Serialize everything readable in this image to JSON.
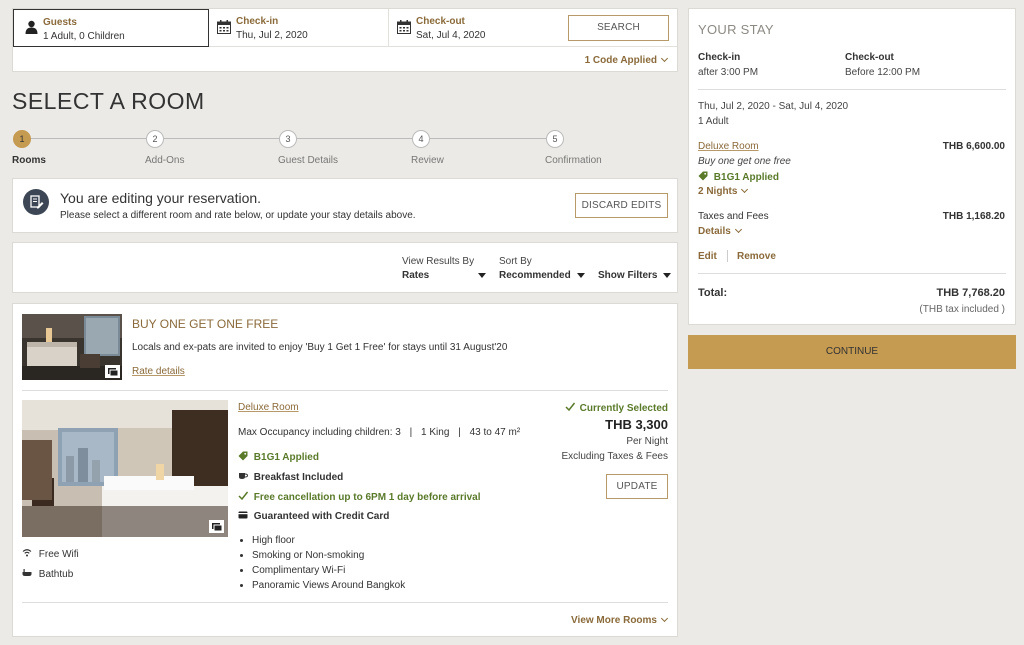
{
  "search_bar": {
    "guests_label": "Guests",
    "guests_value": "1 Adult, 0 Children",
    "checkin_label": "Check-in",
    "checkin_value": "Thu, Jul 2, 2020",
    "checkout_label": "Check-out",
    "checkout_value": "Sat, Jul 4, 2020",
    "search_button": "SEARCH",
    "codes_link": "1 Code Applied"
  },
  "page_title": "SELECT A ROOM",
  "steps": [
    {
      "num": "1",
      "label": "Rooms",
      "active": true
    },
    {
      "num": "2",
      "label": "Add-Ons"
    },
    {
      "num": "3",
      "label": "Guest Details"
    },
    {
      "num": "4",
      "label": "Review"
    },
    {
      "num": "5",
      "label": "Confirmation"
    }
  ],
  "edit_notice": {
    "title": "You are editing your reservation.",
    "subtitle": "Please select a different room and rate below, or update your stay details above.",
    "discard_button": "DISCARD EDITS"
  },
  "filters": {
    "view_by_label": "View Results By",
    "view_by_value": "Rates",
    "sort_label": "Sort By",
    "sort_value": "Recommended",
    "show_filters": "Show Filters"
  },
  "offer": {
    "title": "BUY ONE GET ONE FREE",
    "description": "Locals and ex-pats are invited to enjoy 'Buy 1 Get 1 Free' for stays until 31 August'20",
    "rate_details_link": "Rate details"
  },
  "room": {
    "name": "Deluxe Room",
    "occupancy": "Max Occupancy including children: 3",
    "bed": "1 King",
    "size": "43 to 47 m²",
    "promo_applied": "B1G1 Applied",
    "breakfast": "Breakfast Included",
    "cancellation": "Free cancellation up to 6PM 1 day before arrival",
    "guarantee": "Guaranteed with Credit Card",
    "features": [
      "High floor",
      "Smoking or Non-smoking",
      "Complimentary Wi-Fi",
      "Panoramic Views Around Bangkok"
    ],
    "amenities": [
      "Free Wifi",
      "Bathtub"
    ],
    "selected_label": "Currently Selected",
    "price": "THB 3,300",
    "per_night": "Per Night",
    "excl_taxes": "Excluding Taxes & Fees",
    "update_button": "UPDATE",
    "more_rooms_link": "View More Rooms"
  },
  "your_stay": {
    "title": "YOUR STAY",
    "checkin_label": "Check-in",
    "checkin_time": "after 3:00 PM",
    "checkout_label": "Check-out",
    "checkout_time": "Before 12:00 PM",
    "dates": "Thu, Jul 2, 2020 - Sat, Jul 4, 2020",
    "guests": "1 Adult",
    "room_name": "Deluxe Room",
    "room_price": "THB 6,600.00",
    "room_offer": "Buy one get one free",
    "promo_applied": "B1G1 Applied",
    "nights": "2 Nights",
    "taxes_label": "Taxes and Fees",
    "taxes_value": "THB 1,168.20",
    "details_link": "Details",
    "edit_link": "Edit",
    "remove_link": "Remove",
    "total_label": "Total:",
    "total_value": "THB 7,768.20",
    "tax_note": "(THB tax included )",
    "continue_button": "CONTINUE"
  },
  "colors": {
    "accent": "#c59a51",
    "brand_text": "#8a6a3a",
    "success": "#5a7a2a"
  }
}
